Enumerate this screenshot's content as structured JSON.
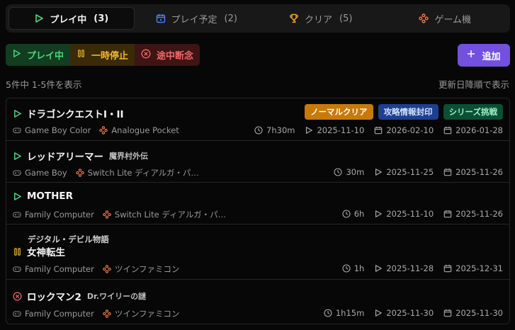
{
  "tabs": [
    {
      "label": "プレイ中",
      "count": "(3)",
      "icon": "play-icon",
      "active": true,
      "color": "#4fd67a"
    },
    {
      "label": "プレイ予定",
      "count": "(2)",
      "icon": "calendar-icon",
      "active": false,
      "color": "#4d7ff0"
    },
    {
      "label": "クリア",
      "count": "(5)",
      "icon": "trophy-icon",
      "active": false,
      "color": "#f2a52f"
    },
    {
      "label": "ゲーム機",
      "count": "",
      "icon": "gamepad-icon",
      "active": false,
      "color": "#f07a4a"
    }
  ],
  "filters": [
    {
      "label": "プレイ中",
      "icon": "play-icon",
      "color": "#4fd67a"
    },
    {
      "label": "一時停止",
      "icon": "pause-icon",
      "color": "#f2b82f"
    },
    {
      "label": "途中断念",
      "icon": "x-circle-icon",
      "color": "#f06a6a"
    }
  ],
  "add_button": {
    "label": "追加",
    "icon": "plus-icon"
  },
  "summary": "5件中 1-5件を表示",
  "sort": "更新日降順で表示",
  "games": [
    {
      "title": "ドラゴンクエストI・II",
      "subtitle": "",
      "kicker": "",
      "status": "playing",
      "tags": [
        {
          "label": "ノーマルクリア",
          "color": "orange"
        },
        {
          "label": "攻略情報封印",
          "color": "blue"
        },
        {
          "label": "シリーズ挑戦",
          "color": "teal"
        }
      ],
      "console": "Game Boy Color",
      "platform": "Analogue Pocket",
      "playtime": "7h30m",
      "started": "2025-11-10",
      "planned": "2026-02-10",
      "updated": "2026-01-28"
    },
    {
      "title": "レッドアリーマー",
      "subtitle": "魔界村外伝",
      "kicker": "",
      "status": "playing",
      "tags": [],
      "console": "Game Boy",
      "platform": "Switch Lite ディアルガ・パ…",
      "playtime": "30m",
      "started": "2025-11-25",
      "planned": "",
      "updated": "2025-11-26"
    },
    {
      "title": "MOTHER",
      "subtitle": "",
      "kicker": "",
      "status": "playing",
      "tags": [],
      "console": "Family Computer",
      "platform": "Switch Lite ディアルガ・パ…",
      "playtime": "6h",
      "started": "2025-11-10",
      "planned": "",
      "updated": "2025-11-26"
    },
    {
      "title": "女神転生",
      "subtitle": "",
      "kicker": "デジタル・デビル物語",
      "status": "paused",
      "tags": [],
      "console": "Family Computer",
      "platform": "ツインファミコン",
      "playtime": "1h",
      "started": "2025-11-28",
      "planned": "",
      "updated": "2025-12-31"
    },
    {
      "title": "ロックマン2",
      "subtitle": "Dr.ワイリーの謎",
      "kicker": "",
      "status": "abandoned",
      "tags": [],
      "console": "Family Computer",
      "platform": "ツインファミコン",
      "playtime": "1h15m",
      "started": "2025-11-30",
      "planned": "",
      "updated": "2025-11-30"
    }
  ]
}
